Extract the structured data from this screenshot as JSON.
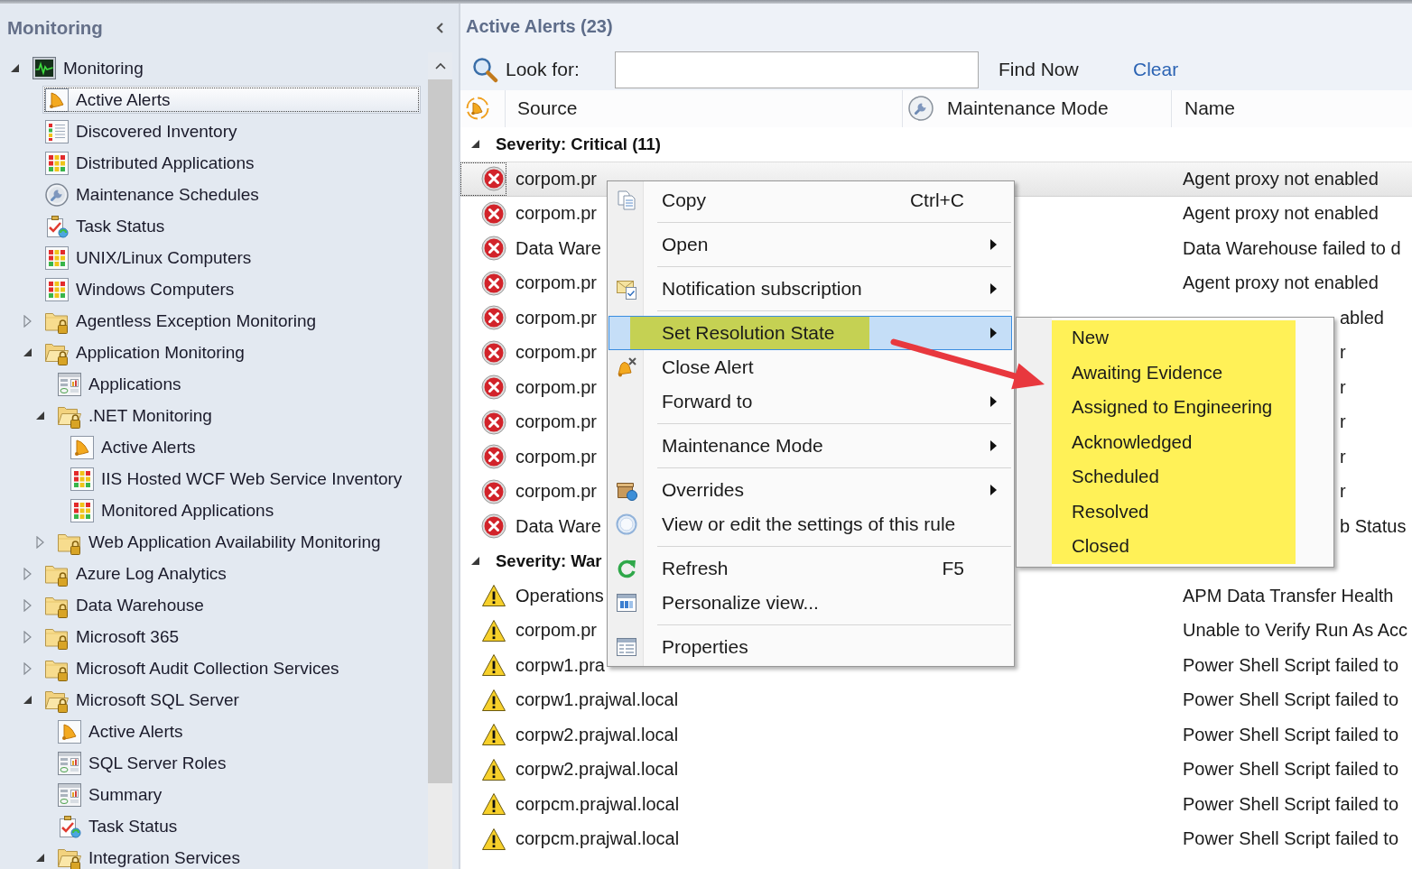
{
  "sidebar": {
    "title": "Monitoring",
    "tree": [
      {
        "label": "Monitoring",
        "kind": "monitoring",
        "expanded": true,
        "selected": false,
        "children": [
          {
            "label": "Active Alerts",
            "kind": "alerts",
            "selected": true
          },
          {
            "label": "Discovered Inventory",
            "kind": "inventory",
            "selected": false
          },
          {
            "label": "Distributed Applications",
            "kind": "state",
            "selected": false
          },
          {
            "label": "Maintenance Schedules",
            "kind": "schedule",
            "selected": false
          },
          {
            "label": "Task Status",
            "kind": "task",
            "selected": false
          },
          {
            "label": "UNIX/Linux Computers",
            "kind": "state",
            "selected": false
          },
          {
            "label": "Windows Computers",
            "kind": "state",
            "selected": false
          },
          {
            "label": "Agentless Exception Monitoring",
            "kind": "folder",
            "expanded": false,
            "selected": false
          },
          {
            "label": "Application Monitoring",
            "kind": "folder",
            "expanded": true,
            "selected": false,
            "children": [
              {
                "label": "Applications",
                "kind": "dashboard",
                "selected": false
              },
              {
                "label": ".NET Monitoring",
                "kind": "folder",
                "expanded": true,
                "selected": false,
                "children": [
                  {
                    "label": "Active Alerts",
                    "kind": "alerts",
                    "selected": false
                  },
                  {
                    "label": "IIS Hosted WCF Web Service Inventory",
                    "kind": "state",
                    "selected": false
                  },
                  {
                    "label": "Monitored Applications",
                    "kind": "state",
                    "selected": false
                  }
                ]
              },
              {
                "label": "Web Application Availability Monitoring",
                "kind": "folder",
                "expanded": false,
                "selected": false
              }
            ]
          },
          {
            "label": "Azure Log Analytics",
            "kind": "folder",
            "expanded": false,
            "selected": false
          },
          {
            "label": "Data Warehouse",
            "kind": "folder",
            "expanded": false,
            "selected": false
          },
          {
            "label": "Microsoft 365",
            "kind": "folder",
            "expanded": false,
            "selected": false
          },
          {
            "label": "Microsoft Audit Collection Services",
            "kind": "folder",
            "expanded": false,
            "selected": false
          },
          {
            "label": "Microsoft SQL Server",
            "kind": "folder",
            "expanded": true,
            "selected": false,
            "children": [
              {
                "label": "Active Alerts",
                "kind": "alerts",
                "selected": false
              },
              {
                "label": "SQL Server Roles",
                "kind": "dashboard",
                "selected": false
              },
              {
                "label": "Summary",
                "kind": "dashboard",
                "selected": false
              },
              {
                "label": "Task Status",
                "kind": "task",
                "selected": false
              },
              {
                "label": "Integration Services",
                "kind": "folder",
                "expanded": true,
                "selected": false
              }
            ]
          }
        ]
      }
    ]
  },
  "alerts_view": {
    "title": "Active Alerts (23)",
    "search": {
      "label": "Look for:",
      "button": "Find Now",
      "link": "Clear"
    },
    "columns": [
      {
        "kind": "severity"
      },
      {
        "kind": "text",
        "label": "Source"
      },
      {
        "kind": "maintenance",
        "label": "Maintenance Mode"
      },
      {
        "kind": "text",
        "label": "Name"
      }
    ],
    "groups": [
      {
        "label": "Severity: Critical (11)",
        "kind": "critical",
        "expanded": true,
        "rows": [
          {
            "source": "corpom.pr",
            "name": "Agent proxy not enabled",
            "selected": true,
            "covered": false
          },
          {
            "source": "corpom.pr",
            "name": "Agent proxy not enabled",
            "selected": false,
            "covered": false
          },
          {
            "source": "Data Ware",
            "name": "Data Warehouse failed to d",
            "selected": false,
            "covered": false
          },
          {
            "source": "corpom.pr",
            "name": "Agent proxy not enabled",
            "selected": false,
            "covered": false
          },
          {
            "source": "corpom.pr",
            "name": "abled",
            "selected": false,
            "covered": true
          },
          {
            "source": "corpom.pr",
            "name": "r",
            "selected": false,
            "covered": true
          },
          {
            "source": "corpom.pr",
            "name": "r",
            "selected": false,
            "covered": true
          },
          {
            "source": "corpom.pr",
            "name": "r",
            "selected": false,
            "covered": true
          },
          {
            "source": "corpom.pr",
            "name": "r",
            "selected": false,
            "covered": true
          },
          {
            "source": "corpom.pr",
            "name": "r",
            "selected": false,
            "covered": true
          },
          {
            "source": "Data Ware",
            "name": "b Status",
            "selected": false,
            "covered": true
          }
        ]
      },
      {
        "label": "Severity: War",
        "kind": "warning",
        "expanded": true,
        "rows": [
          {
            "source": "Operations",
            "name": "APM Data Transfer Health",
            "selected": false,
            "covered": false
          },
          {
            "source": "corpom.pr",
            "name": "Unable to Verify Run As Acc",
            "selected": false,
            "covered": false
          },
          {
            "source": "corpw1.pra",
            "name": "Power Shell Script failed to",
            "selected": false,
            "covered": false
          },
          {
            "source": "corpw1.prajwal.local",
            "name": "Power Shell Script failed to",
            "selected": false,
            "covered": false
          },
          {
            "source": "corpw2.prajwal.local",
            "name": "Power Shell Script failed to",
            "selected": false,
            "covered": false
          },
          {
            "source": "corpw2.prajwal.local",
            "name": "Power Shell Script failed to",
            "selected": false,
            "covered": false
          },
          {
            "source": "corpcm.prajwal.local",
            "name": "Power Shell Script failed to",
            "selected": false,
            "covered": false
          },
          {
            "source": "corpcm.prajwal.local",
            "name": "Power Shell Script failed to",
            "selected": false,
            "covered": false
          }
        ]
      }
    ]
  },
  "context_menu": {
    "items": [
      {
        "kind": "copy",
        "label": "Copy",
        "shortcut": "Ctrl+C",
        "has_submenu": false,
        "selected": false,
        "highlighted": false
      },
      {
        "kind": "separator"
      },
      {
        "kind": "plain",
        "label": "Open",
        "has_submenu": true,
        "selected": false,
        "highlighted": false
      },
      {
        "kind": "separator"
      },
      {
        "kind": "notification",
        "label": "Notification subscription",
        "has_submenu": true,
        "selected": false,
        "highlighted": false
      },
      {
        "kind": "separator"
      },
      {
        "kind": "plain",
        "label": "Set Resolution State",
        "has_submenu": true,
        "selected": true,
        "highlighted": true
      },
      {
        "kind": "close",
        "label": "Close Alert",
        "has_submenu": false,
        "selected": false,
        "highlighted": false
      },
      {
        "kind": "plain",
        "label": "Forward to",
        "has_submenu": true,
        "selected": false,
        "highlighted": false
      },
      {
        "kind": "separator"
      },
      {
        "kind": "plain",
        "label": "Maintenance Mode",
        "has_submenu": true,
        "selected": false,
        "highlighted": false
      },
      {
        "kind": "separator"
      },
      {
        "kind": "overrides",
        "label": "Overrides",
        "has_submenu": true,
        "selected": false,
        "highlighted": false
      },
      {
        "kind": "settings",
        "label": "View or edit the settings of this rule",
        "has_submenu": false,
        "selected": false,
        "highlighted": false
      },
      {
        "kind": "separator"
      },
      {
        "kind": "refresh",
        "label": "Refresh",
        "shortcut": "F5",
        "has_submenu": false,
        "selected": false,
        "highlighted": false
      },
      {
        "kind": "personalize",
        "label": "Personalize view...",
        "has_submenu": false,
        "selected": false,
        "highlighted": false
      },
      {
        "kind": "separator"
      },
      {
        "kind": "properties",
        "label": "Properties",
        "has_submenu": false,
        "selected": false,
        "highlighted": false
      }
    ]
  },
  "submenu": {
    "highlighted": true,
    "items": [
      {
        "label": "New",
        "selected": false
      },
      {
        "label": "Awaiting Evidence",
        "selected": false
      },
      {
        "label": "Assigned to Engineering",
        "selected": false
      },
      {
        "label": "Acknowledged",
        "selected": false
      },
      {
        "label": "Scheduled",
        "selected": false
      },
      {
        "label": "Resolved",
        "selected": false
      },
      {
        "label": "Closed",
        "selected": false
      }
    ]
  },
  "annotations": [
    {
      "kind": "arrow"
    }
  ]
}
